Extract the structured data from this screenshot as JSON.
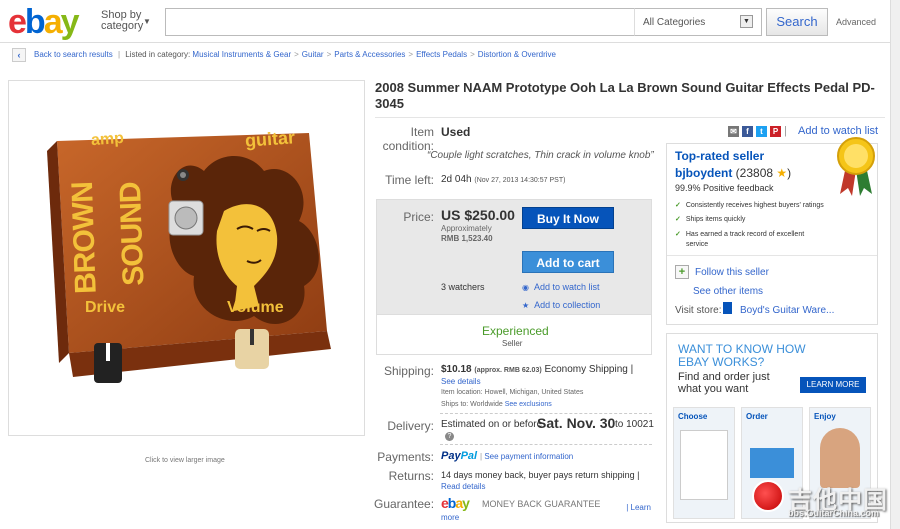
{
  "header": {
    "logo": {
      "e": "e",
      "b": "b",
      "a": "a",
      "y": "y"
    },
    "shop_by_1": "Shop by",
    "shop_by_2": "category",
    "search_placeholder": "",
    "category_value": "All Categories",
    "search_label": "Search",
    "advanced_label": "Advanced"
  },
  "breadcrumb": {
    "back": "Back to search results",
    "sep_listed": "|",
    "listed_in": "Listed in category:",
    "items": [
      "Musical Instruments & Gear",
      "Guitar",
      "Parts & Accessories",
      "Effects Pedals",
      "Distortion & Overdrive"
    ],
    "arrow": ">"
  },
  "image": {
    "caption": "Click to view larger image",
    "pedal_text": {
      "amp": "amp",
      "guitar": "guitar",
      "brown": "BROWN",
      "sound": "SOUND",
      "drive": "Drive",
      "volume": "Volume"
    }
  },
  "item": {
    "title": "2008 Summer NAAM Prototype Ooh La La Brown Sound Guitar Effects Pedal PD-3045",
    "condition_label_1": "Item",
    "condition_label_2": "condition:",
    "condition_value": "Used",
    "condition_quote": "“Couple light scratches, Thin crack in volume knob”",
    "time_left_label": "Time left:",
    "time_left_value": "2d 04h",
    "time_left_detail": "(Nov 27, 2013    14:30:57 PST)",
    "price_label": "Price:",
    "price_value": "US $250.00",
    "approx_1": "Approximately",
    "approx_2": "RMB 1,523.40",
    "buy_now": "Buy It Now",
    "add_to_cart": "Add to cart",
    "watchers": "3 watchers",
    "add_watch": "Add to watch list",
    "add_collection": "Add to collection",
    "experienced": "Experienced",
    "seller_word": "Seller",
    "shipping_label": "Shipping:",
    "shipping_price": "$10.18",
    "shipping_approx": "(approx. RMB 62.03)",
    "shipping_method": "Economy Shipping |",
    "see_details": "See details",
    "item_location": "Item location:   Howell, Michigan, United States",
    "ships_to_pre": "Ships to:   Worldwide",
    "see_exclusions": "See exclusions",
    "delivery_label": "Delivery:",
    "delivery_pre": "Estimated on or before",
    "delivery_date": "Sat. Nov. 30",
    "delivery_post": "to 10021",
    "info": "?",
    "payments_label": "Payments:",
    "paypal_1": "Pay",
    "paypal_2": "Pal",
    "payment_info_bar": "|",
    "payment_info": "See payment information",
    "returns_label": "Returns:",
    "returns_value": "14 days money back, buyer pays return shipping |",
    "read_details": "Read details",
    "guarantee_label": "Guarantee:",
    "guarantee_text": "MONEY BACK GUARANTEE",
    "learn": "| Learn",
    "more": "more"
  },
  "share": {
    "email": "✉",
    "facebook": "f",
    "twitter": "t",
    "pinterest": "P",
    "sep": "|",
    "watch_list": "Add to watch list"
  },
  "seller": {
    "top_rated": "Top-rated seller",
    "name": "bjboydent",
    "feedback": "(23808",
    "star": "★",
    "close": ")",
    "positive": "99.9% Positive feedback",
    "checks": [
      "Consistently receives highest buyers' ratings",
      "Ships items quickly",
      "Has earned a track record of excellent service"
    ],
    "tick": "✓",
    "plus": "+",
    "follow": "Follow this seller",
    "other_items": "See other items",
    "visit_store": "Visit store:",
    "store_name": "Boyd's Guitar Ware..."
  },
  "ad": {
    "headline": "WANT TO KNOW HOW EBAY WORKS?",
    "sub": "Find and order just what you want",
    "learn_more": "LEARN MORE",
    "cols": [
      "Choose",
      "Order",
      "Enjoy"
    ]
  },
  "watermark": {
    "cn": "吉他中国",
    "url": "bbs.GuitarChina.com"
  },
  "colors": {
    "link": "#3366cc",
    "buy_button": "#0654ba",
    "cart_button": "#3b8fd9",
    "experienced": "#4a9b2a",
    "pedal_body": "#b5551e",
    "pedal_text": "#f3c13a"
  }
}
